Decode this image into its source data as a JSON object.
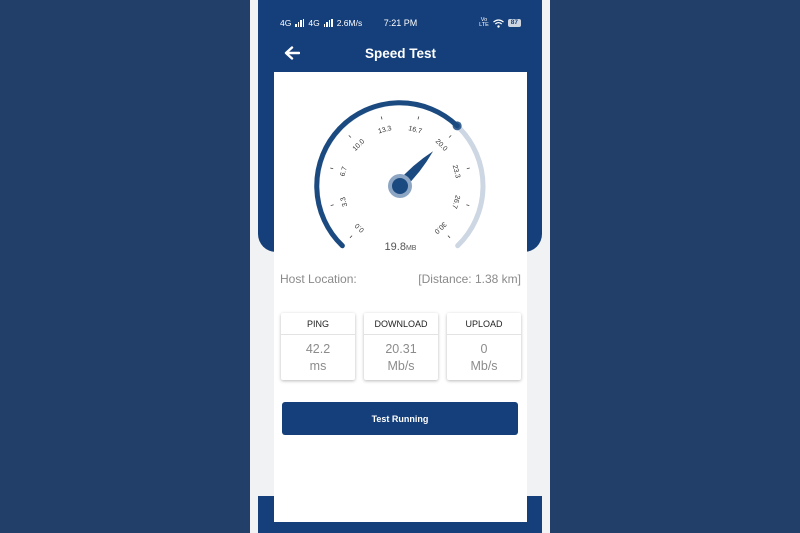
{
  "status_bar": {
    "network1": "4G",
    "network2": "4G",
    "speed": "2.6M/s",
    "time": "7:21 PM",
    "volte": "Vo\nLTE",
    "battery": "87"
  },
  "header": {
    "title": "Speed Test",
    "back_icon": "arrow-left-icon"
  },
  "gauge": {
    "ticks": [
      "0.0",
      "3.3",
      "6.7",
      "10.0",
      "13.3",
      "16.7",
      "20.0",
      "23.3",
      "26.7",
      "30.0"
    ],
    "min": 0,
    "max": 30,
    "current": 19.8,
    "value_text": "19.8",
    "unit": "MB",
    "colors": {
      "active": "#1b4a80",
      "inactive": "#cdd6e3",
      "needle": "#1b4a80",
      "hub_ring": "#8da6c4"
    }
  },
  "host": {
    "label": "Host Location:",
    "distance": "[Distance: 1.38 km]"
  },
  "stats": [
    {
      "title": "PING",
      "value": "42.2",
      "unit": "ms"
    },
    {
      "title": "DOWNLOAD",
      "value": "20.31",
      "unit": "Mb/s"
    },
    {
      "title": "UPLOAD",
      "value": "0",
      "unit": "Mb/s"
    }
  ],
  "button": {
    "label": "Test Running"
  },
  "colors": {
    "brand": "#153f7a",
    "background": "#213f68"
  }
}
